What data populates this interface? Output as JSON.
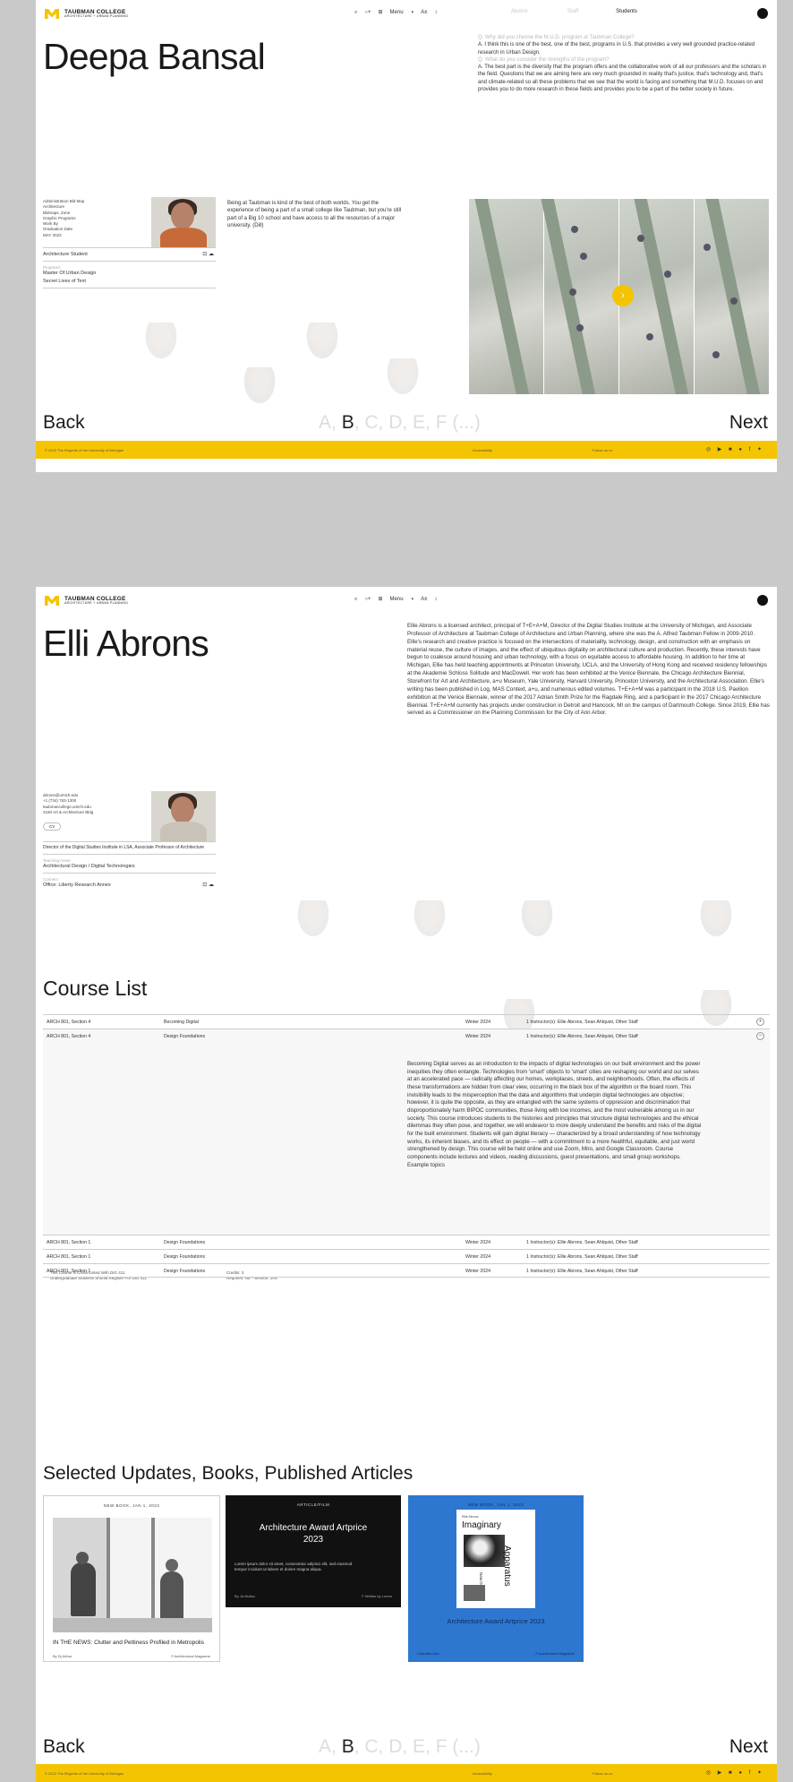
{
  "header": {
    "logo_title": "TAUBMAN COLLEGE",
    "logo_sub": "ARCHITECTURE + URBAN PLANNING",
    "controls": [
      "⌕",
      "○+",
      "⊞",
      "Menu",
      "◑",
      "A±",
      "↕"
    ],
    "roles": [
      "Alumni",
      "Staff",
      "Students"
    ],
    "active_role": "Students"
  },
  "screen1": {
    "name": "Deepa Bansal",
    "qa": [
      {
        "q": "Q.    Why did you choose the M.U.D. program at Taubman College?",
        "a": "A.    I think this is one of the best, one of the best, programs in U.S. that provides a very well grounded practice-related research in Urban Design."
      },
      {
        "q": "Q.    What do you consider the strengths of the program?",
        "a": "A.    The best part is the diversity that the program offers and the collaborative work of all our professors and the scholars in the field. Questions that we are aiming here are very much grounded in reality that's justice, that's technology and, that's and climate-related so all these problems that we see that the world is facing and something that M.U.D. focuses on and provides you to do more research in these fields and provides you to be a part of the better society in future."
      }
    ],
    "card": {
      "info": [
        "Administration Bld Map",
        "Architecture",
        "Bldmaps, Zone",
        "Graphic Programs",
        "Work By",
        "Graduation Date",
        "MAY 2023"
      ],
      "role": "Architecture Student",
      "program_label": "Programs",
      "programs": [
        "Master Of Urban Design",
        "Secret Lives of Text"
      ]
    },
    "quote": "Being at Taubman is kind of the best of both worlds. You get the experience of being a part of a small college like Taubman, but you're still part of a Big 10 school and have access to all the resources of a major university. (Dill)",
    "arrow_icon": "›",
    "nav": {
      "back": "Back",
      "next": "Next",
      "letter_pre": "A,",
      "letter_active": "B",
      "letter_post": ", C, D, E, F (...)"
    },
    "footer": {
      "left": "© 2023 The Regents of the University of Michigan",
      "mid": "Accessibility",
      "right": "Follow us on",
      "icons": "◎ ▶ ■ ● f ✦"
    }
  },
  "screen2": {
    "name": "Elli Abrons",
    "bio": "Ellie Abrons is a licensed architect, principal of T+E+A+M, Director of the Digital Studies Institute at the University of Michigan, and Associate Professor of Architecture at Taubman College of Architecture and Urban Planning, where she was the A. Alfred Taubman Fellow in 2009-2010. Ellie's research and creative practice is focused on the intersections of materiality, technology, design, and construction with an emphasis on material reuse, the culture of images, and the effect of ubiquitous digitality on architectural culture and production. Recently, these interests have begun to coalesce around housing and urban technology, with a focus on equitable access to affordable housing. In addition to her time at Michigan, Ellie has held teaching appointments at Princeton University, UCLA, and the University of Hong Kong and received residency fellowships at the Akademie Schloss Solitude and MacDowell. Her work has been exhibited at the Venice Biennale, the Chicago Architecture Biennial, Storefront for Art and Architecture, a+u Museum, Yale University, Harvard University, Princeton University, and the Architectural Association. Ellie's writing has been published in Log, MAS Context, a+u, and numerous edited volumes. T+E+A+M was a participant in the 2018 U.S. Pavilion exhibition at the Venice Biennale, winner of the 2017 Adrian Smith Prize for the Ragdale Ring, and a participant in the 2017 Chicago Architecture Biennial. T+E+A+M currently has projects under construction in Detroit and Hancock, MI on the campus of Dartmouth College. Since 2019, Ellie has served as a Commissioner on the Planning Commission for the City of Ann Arbor.",
    "card": {
      "info": [
        "abrons@umich.edu",
        "+1 (734) 763-1300",
        "taubmancollege.umich.edu",
        "2150 Art & Architecture Bldg"
      ],
      "badge": "CV",
      "title": "Director of the Digital Studies Institute in LSA, Associate Professor of Architecture",
      "area_label": "Teaching Areas",
      "area": "Architectural Design / Digital Technologies",
      "office_label": "Connect",
      "office": "Office: Liberty Research Annex"
    },
    "course_heading": "Course List",
    "courses": [
      {
        "code": "ARCH 801, Section 4",
        "title": "Becoming Digital",
        "term": "Winter 2024",
        "instructors": "1 Instructor(s): Ellie Abrons, Sean Ahlquist, Other Staff",
        "toggle": "+"
      },
      {
        "code": "ARCH 801, Section 4",
        "title": "Design Foundations",
        "term": "Winter 2024",
        "instructors": "1 Instructor(s): Ellie Abrons, Sean Ahlquist, Other Staff",
        "toggle": "–"
      },
      {
        "code": "ARCH 801, Section 1",
        "title": "Design Foundations",
        "term": "Winter 2024",
        "instructors": "1 Instructor(s): Ellie Abrons, Sean Ahlquist, Other Staff",
        "toggle": ""
      },
      {
        "code": "ARCH 801, Section 1",
        "title": "Design Foundations",
        "term": "Winter 2024",
        "instructors": "1 Instructor(s): Ellie Abrons, Sean Ahlquist, Other Staff",
        "toggle": ""
      },
      {
        "code": "ARCH 801, Section 1",
        "title": "Design Foundations",
        "term": "Winter 2024",
        "instructors": "1 Instructor(s): Ellie Abrons, Sean Ahlquist, Other Staff",
        "toggle": ""
      }
    ],
    "course_desc": "Becoming Digital serves as an introduction to the impacts of digital technologies on our built environment and the power inequities they often entangle. Technologies from 'smart' objects to 'smart' cities are reshaping our world and our selves at an accelerated pace — radically affecting our homes, workplaces, streets, and neighborhoods. Often, the effects of these transformations are hidden from clear view, occurring in the black box of the algorithm or the board room. This invisibility leads to the misperception that the data and algorithms that underpin digital technologies are objective; however, it is quite the opposite, as they are entangled with the same systems of oppression and discrimination that disproportionately harm BIPOC communities, those living with low incomes, and the most vulnerable among us in our society. This course introduces students to the histories and principles that structure digital technologies and the ethical dilemmas they often pose, and together, we will endeavor to more deeply understand the benefits and risks of the digital for the built environment. Students will gain digital literacy — characterized by a broad understanding of how technology works, its inherent biases, and its effect on people — with a commitment to a more healthful, equitable, and just world strengthened by design. This course will be held online and use Zoom, Miro, and Google Classroom. Course components include lectures and videos, reading discussions, guest presentations, and small group workshops. Example topics",
    "course_meta": [
      "This Course Is Cross-Listed With DIG 411",
      "Undergraduate Students Should Register For DIG 411",
      "Credits: 3",
      "Requires: No – Section: 1A4"
    ],
    "pubs_heading": "Selected Updates, Books, Published Articles",
    "pubs": [
      {
        "tag": "NEW BOOK, JAN 1, 2023",
        "title": "IN THE NEWS: Clutter and Pettiness Profiled in Metropolis",
        "by": "By Dj Arthur",
        "src": "↗ Architectural Magazine"
      },
      {
        "tag": "ARTICLE/FILM",
        "award": "Architecture Award Artprice 2023",
        "body": "Lorem ipsum dolor sit amet, consectetur adipisci elit, sed eiusmod tempor incidunt ut labore et dolore magna aliqua.",
        "by": "By Ja Muñoz",
        "src": "↗ Written by Lorem"
      },
      {
        "tag": "NEW BOOK, JAN 1, 2023",
        "book_top": "Ellie Abrons",
        "book_title": "Imaginary",
        "book_side": "Apparatus",
        "book_sub": "New Data Ones",
        "award": "Architecture Award Artprice 2023",
        "by": "Chandler Alex",
        "src": "↗ Architectural Magazine"
      }
    ],
    "nav": {
      "back": "Back",
      "next": "Next",
      "letter_pre": "A,",
      "letter_active": "B",
      "letter_post": ", C, D, E, F (...)"
    },
    "footer": {
      "left": "© 2023 The Regents of the University of Michigan",
      "mid": "Accessibility",
      "right": "Follow us on",
      "icons": "◎ ▶ ■ ● f ✦"
    }
  },
  "colors": {
    "accent": "#f5c400",
    "blue": "#2e77d0",
    "dark": "#111111"
  }
}
